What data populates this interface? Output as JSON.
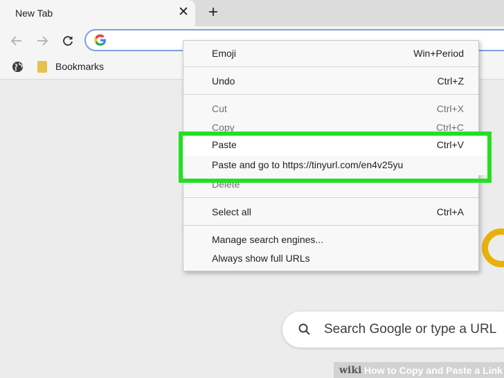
{
  "tab": {
    "title": "New Tab",
    "close_glyph": "✕",
    "new_tab_glyph": "+"
  },
  "toolbar": {
    "back_icon": "back-arrow-icon",
    "forward_icon": "forward-arrow-icon",
    "reload_icon": "reload-icon"
  },
  "bookmarks": {
    "label": "Bookmarks"
  },
  "context_menu": {
    "items": [
      {
        "label": "Emoji",
        "shortcut": "Win+Period",
        "enabled": true
      },
      {
        "label": "Undo",
        "shortcut": "Ctrl+Z",
        "enabled": true
      },
      {
        "label": "Cut",
        "shortcut": "Ctrl+X",
        "enabled": false
      },
      {
        "label": "Copy",
        "shortcut": "Ctrl+C",
        "enabled": false
      },
      {
        "label": "Paste",
        "shortcut": "Ctrl+V",
        "enabled": true
      },
      {
        "label": "Paste and go to https://tinyurl.com/en4v25yu",
        "shortcut": "",
        "enabled": true
      },
      {
        "label": "Delete",
        "shortcut": "",
        "enabled": false
      },
      {
        "label": "Select all",
        "shortcut": "Ctrl+A",
        "enabled": true
      },
      {
        "label": "Manage search engines...",
        "shortcut": "",
        "enabled": true
      },
      {
        "label": "Always show full URLs",
        "shortcut": "",
        "enabled": true
      }
    ]
  },
  "highlight_color": "#22e022",
  "search": {
    "placeholder": "Search Google or type a URL"
  },
  "watermark": {
    "brand": "wiki",
    "title": "How to Copy and Paste a Link"
  }
}
